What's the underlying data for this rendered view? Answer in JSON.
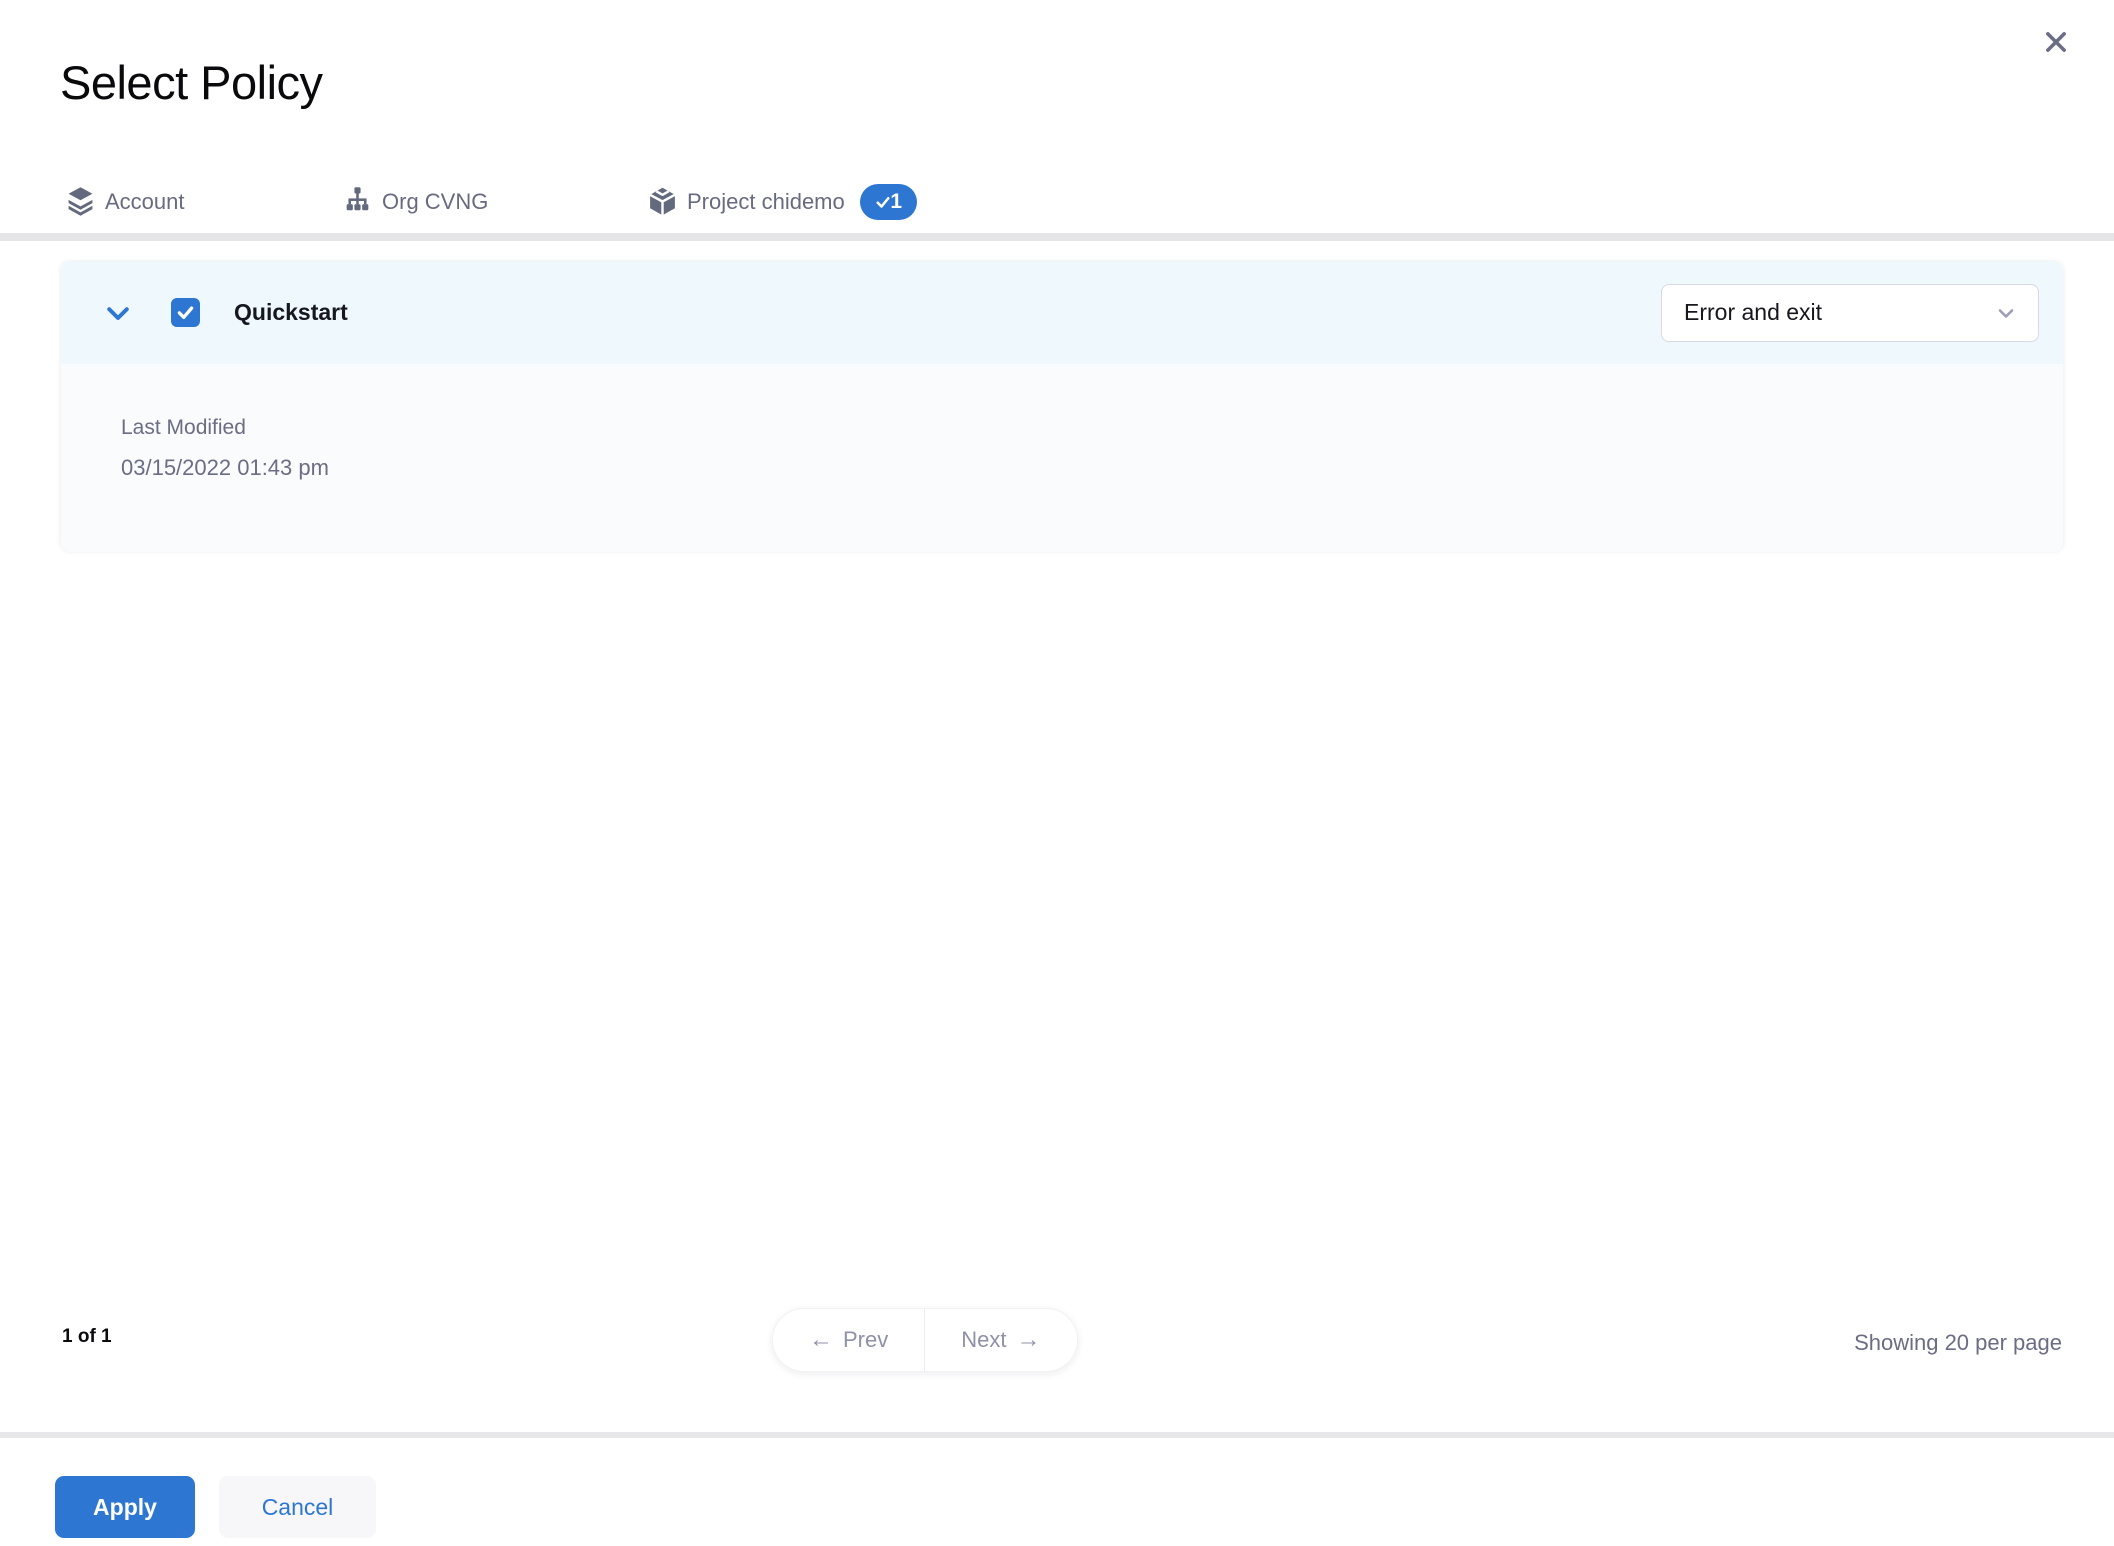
{
  "modal": {
    "title": "Select Policy"
  },
  "tabs": [
    {
      "label": "Account",
      "icon": "layers-icon",
      "active": false
    },
    {
      "label": "Org CVNG",
      "icon": "org-chart-icon",
      "active": false
    },
    {
      "label": "Project chidemo",
      "icon": "cube-icon",
      "active": true,
      "badge_count": "1"
    }
  ],
  "policy": {
    "name": "Quickstart",
    "checked": true,
    "action": "Error and exit",
    "last_modified_label": "Last Modified",
    "last_modified_value": "03/15/2022 01:43 pm"
  },
  "pagination": {
    "page_info": "1 of 1",
    "prev_arrow": "←",
    "prev": "Prev",
    "next": "Next",
    "next_arrow": "→",
    "per_page": "Showing 20 per page"
  },
  "footer": {
    "apply": "Apply",
    "cancel": "Cancel"
  },
  "colors": {
    "primary_blue": "#2d76d2",
    "tab_text_gray": "#6b6d85",
    "header_row_bg": "#eff8fd",
    "details_bg": "#fafbfc",
    "divider_gray": "#e5e5e7",
    "pager_text": "#8f91a8"
  }
}
